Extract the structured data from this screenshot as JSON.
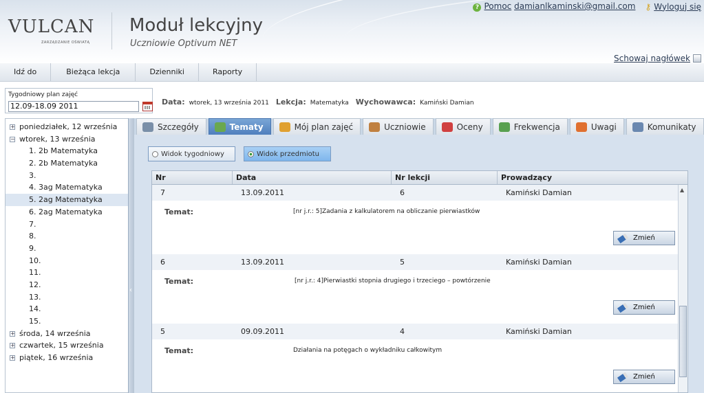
{
  "header": {
    "logo": "VULCAN",
    "logo_sub": "ZARZĄDZANIE OŚWIATĄ",
    "module_title": "Moduł lekcyjny",
    "module_subtitle": "Uczniowie Optivum NET",
    "help_label": "Pomoc",
    "user_email": "damianlkaminski@gmail.com",
    "logout_label": "Wyloguj się",
    "hide_header_label": "Schowaj nagłówek"
  },
  "menu": [
    "Idź do",
    "Bieżąca lekcja",
    "Dzienniki",
    "Raporty"
  ],
  "week": {
    "label": "Tygodniowy plan zajęć",
    "value": "12.09-18.09 2011"
  },
  "info": {
    "date_label": "Data:",
    "date_value": "wtorek, 13 września 2011",
    "lesson_label": "Lekcja:",
    "lesson_value": "Matematyka",
    "tutor_label": "Wychowawca:",
    "tutor_value": "Kamiński Damian"
  },
  "tree": [
    {
      "label": "poniedziałek, 12 września",
      "type": "top",
      "exp": "+"
    },
    {
      "label": "wtorek, 13 września",
      "type": "top",
      "exp": "−"
    },
    {
      "label": "1. 2b Matematyka",
      "type": "child"
    },
    {
      "label": "2. 2b Matematyka",
      "type": "child"
    },
    {
      "label": "3.",
      "type": "child"
    },
    {
      "label": "4. 3ag Matematyka",
      "type": "child"
    },
    {
      "label": "5. 2ag Matematyka",
      "type": "child",
      "selected": true
    },
    {
      "label": "6. 2ag Matematyka",
      "type": "child"
    },
    {
      "label": "7.",
      "type": "child"
    },
    {
      "label": "8.",
      "type": "child"
    },
    {
      "label": "9.",
      "type": "child"
    },
    {
      "label": "10.",
      "type": "child"
    },
    {
      "label": "11.",
      "type": "child"
    },
    {
      "label": "12.",
      "type": "child"
    },
    {
      "label": "13.",
      "type": "child"
    },
    {
      "label": "14.",
      "type": "child"
    },
    {
      "label": "15.",
      "type": "child"
    },
    {
      "label": "środa, 14 września",
      "type": "top",
      "exp": "+"
    },
    {
      "label": "czwartek, 15 września",
      "type": "top",
      "exp": "+"
    },
    {
      "label": "piątek, 16 września",
      "type": "top",
      "exp": "+"
    }
  ],
  "tabs": [
    {
      "label": "Szczegóły",
      "icon": "magnifier-icon",
      "color": "#7a8fa8"
    },
    {
      "label": "Tematy",
      "icon": "topics-icon",
      "color": "#6aa84f",
      "active": true
    },
    {
      "label": "Mój plan zajęć",
      "icon": "schedule-icon",
      "color": "#e0a030"
    },
    {
      "label": "Uczniowie",
      "icon": "students-icon",
      "color": "#c08040"
    },
    {
      "label": "Oceny",
      "icon": "grades-icon",
      "color": "#d04040"
    },
    {
      "label": "Frekwencja",
      "icon": "attendance-icon",
      "color": "#58a050"
    },
    {
      "label": "Uwagi",
      "icon": "remarks-icon",
      "color": "#e07030"
    },
    {
      "label": "Komunikaty",
      "icon": "messages-icon",
      "color": "#6a88b0"
    }
  ],
  "views": {
    "weekly": "Widok tygodniowy",
    "subject": "Widok przedmiotu"
  },
  "grid": {
    "columns": [
      "Nr",
      "Data",
      "Nr lekcji",
      "Prowadzący"
    ],
    "topic_label": "Temat:",
    "edit_label": "Zmień",
    "rows": [
      {
        "nr": "7",
        "date": "13.09.2011",
        "lesson": "6",
        "teacher": "Kamiński Damian",
        "topic": "[nr j.r.: 5]Zadania z kalkulatorem na obliczanie pierwiastków"
      },
      {
        "nr": "6",
        "date": "13.09.2011",
        "lesson": "5",
        "teacher": "Kamiński Damian",
        "topic": "[nr j.r.: 4]Pierwiastki stopnia drugiego i trzeciego – powtórzenie"
      },
      {
        "nr": "5",
        "date": "09.09.2011",
        "lesson": "4",
        "teacher": "Kamiński Damian",
        "topic": "Działania na potęgach o wykładniku całkowitym"
      }
    ]
  }
}
